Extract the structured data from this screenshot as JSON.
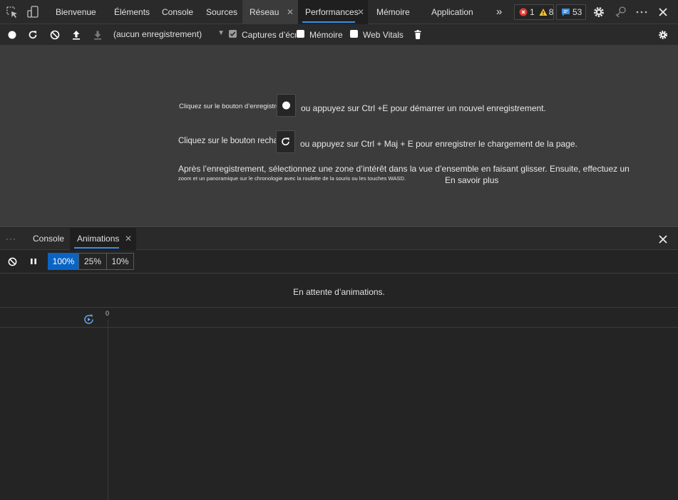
{
  "main_tabs": {
    "bienvenue": "Bienvenue",
    "elements": "Éléments",
    "console": "Console",
    "sources": "Sources",
    "reseau": "Réseau",
    "performances": "Performances",
    "memoire": "Mémoire",
    "application": "Application",
    "close_glyph": "✕",
    "more_tabs_glyph": "»"
  },
  "badges": {
    "errors": "1",
    "warnings": "8",
    "messages": "53"
  },
  "perf_toolbar": {
    "recording_select": "(aucun enregistrement)",
    "screenshots_label": "Captures d’écran",
    "screenshots_checked": true,
    "memory_label": "Mémoire",
    "memory_checked": false,
    "webvitals_label": "Web Vitals",
    "webvitals_checked": false
  },
  "landing": {
    "record_prefix": "Cliquez sur le bouton d’enregistrement",
    "record_suffix": "ou appuyez sur Ctrl +E pour démarrer un nouvel enregistrement.",
    "reload_prefix": "Cliquez sur le bouton recharger",
    "reload_suffix": "ou appuyez sur Ctrl + Maj + E pour enregistrer le chargement de la page.",
    "after_line1": "Après l’enregistrement, sélectionnez une zone d’intérêt dans la vue d’ensemble en faisant glisser. Ensuite, effectuez un",
    "after_line2": "zoom et un panoramique sur le chronologie avec la roulette de la souris ou les touches WASD.",
    "learn_more": "En savoir plus"
  },
  "drawer": {
    "more_glyph": "···",
    "console_tab": "Console",
    "animations_tab": "Animations",
    "close_glyph": "✕"
  },
  "animations": {
    "speeds": [
      "100%",
      "25%",
      "10%"
    ],
    "active_speed": "100%",
    "waiting_message": "En attente d’animations.",
    "timeline_zero": "0"
  },
  "colors": {
    "accent": "#3a8ee6",
    "active_speed_bg": "#0a64c4",
    "error": "#e53935",
    "warning": "#f4c430",
    "message": "#3a8ee6"
  }
}
